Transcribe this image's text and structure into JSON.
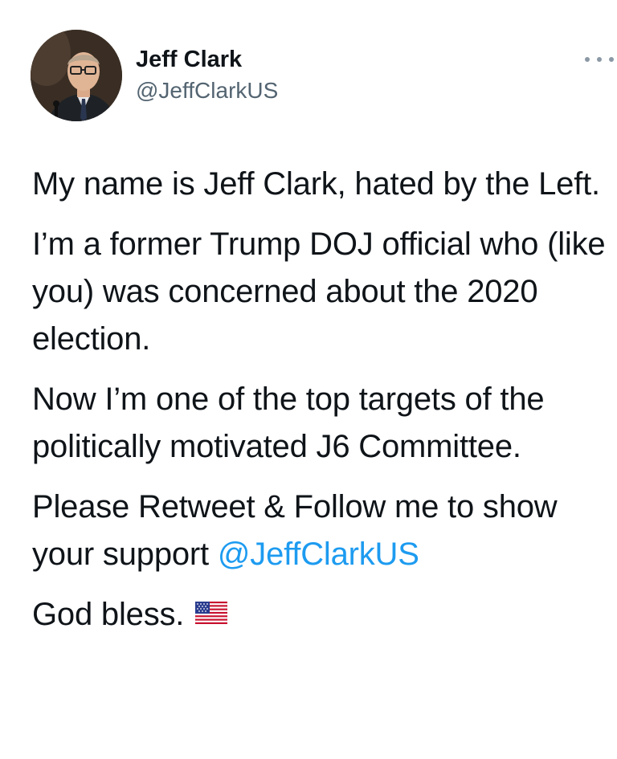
{
  "author": {
    "display_name": "Jeff Clark",
    "handle": "@JeffClarkUS",
    "avatar_icon": "profile-photo"
  },
  "menu": {
    "icon": "more-horizontal-icon"
  },
  "tweet": {
    "paragraph_1": "My name is Jeff Clark, hated by the Left.",
    "paragraph_2": "I’m a former Trump DOJ official who (like you) was concerned about the 2020 election.",
    "paragraph_3": "Now I’m one of the top targets of the politically motivated J6 Committee.",
    "paragraph_4_text": "Please Retweet & Follow me to show your support ",
    "paragraph_4_mention": "@JeffClarkUS",
    "paragraph_5_text": "God bless.",
    "paragraph_5_emoji": "us-flag-icon"
  },
  "colors": {
    "text": "#0f1419",
    "secondary": "#536471",
    "link": "#1d9bf0"
  }
}
